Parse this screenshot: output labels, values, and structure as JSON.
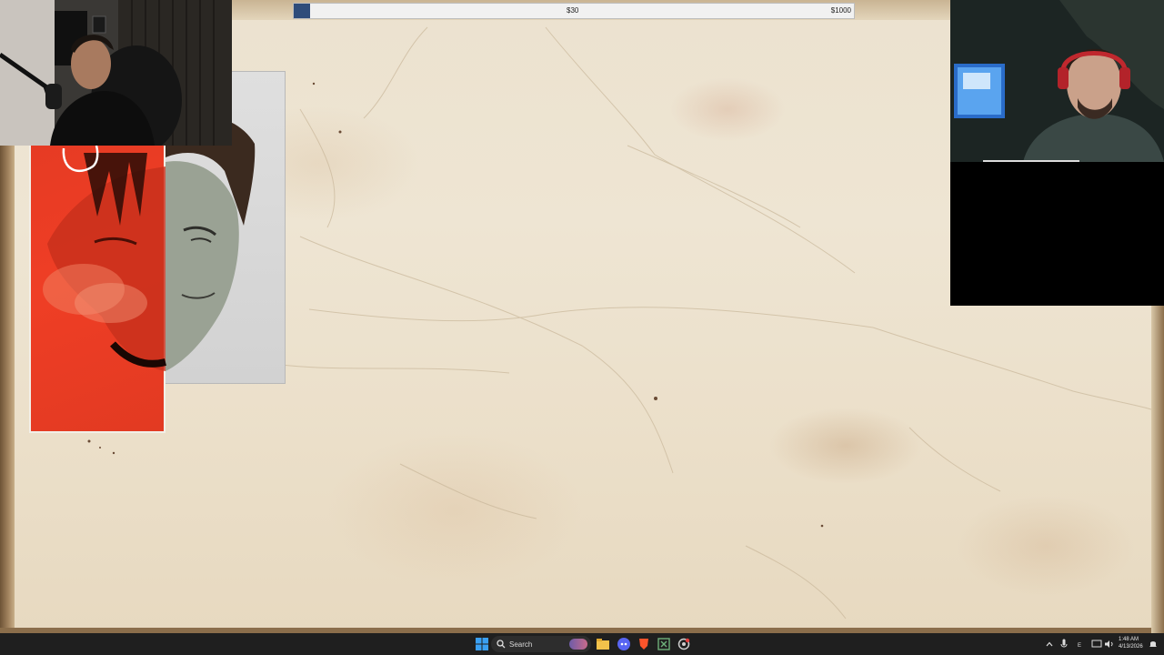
{
  "money_bar": {
    "current_label": "$30",
    "max_label": "$1000",
    "progress": 0.03
  },
  "taskbar": {
    "search_label": "Search",
    "time": "1:48 AM",
    "date": "4/13/2026"
  },
  "icons": {
    "start": "windows-start-icon",
    "search": "search-icon",
    "explorer": "folder-icon",
    "discord": "discord-icon",
    "brave": "brave-browser-icon",
    "xbox": "xbox-icon",
    "app": "settings-icon"
  },
  "colors": {
    "parchment": "#ece2cf",
    "poster_red": "#e63b24",
    "progress_fill": "#2f4c7a",
    "taskbar": "#1f1f1f"
  }
}
